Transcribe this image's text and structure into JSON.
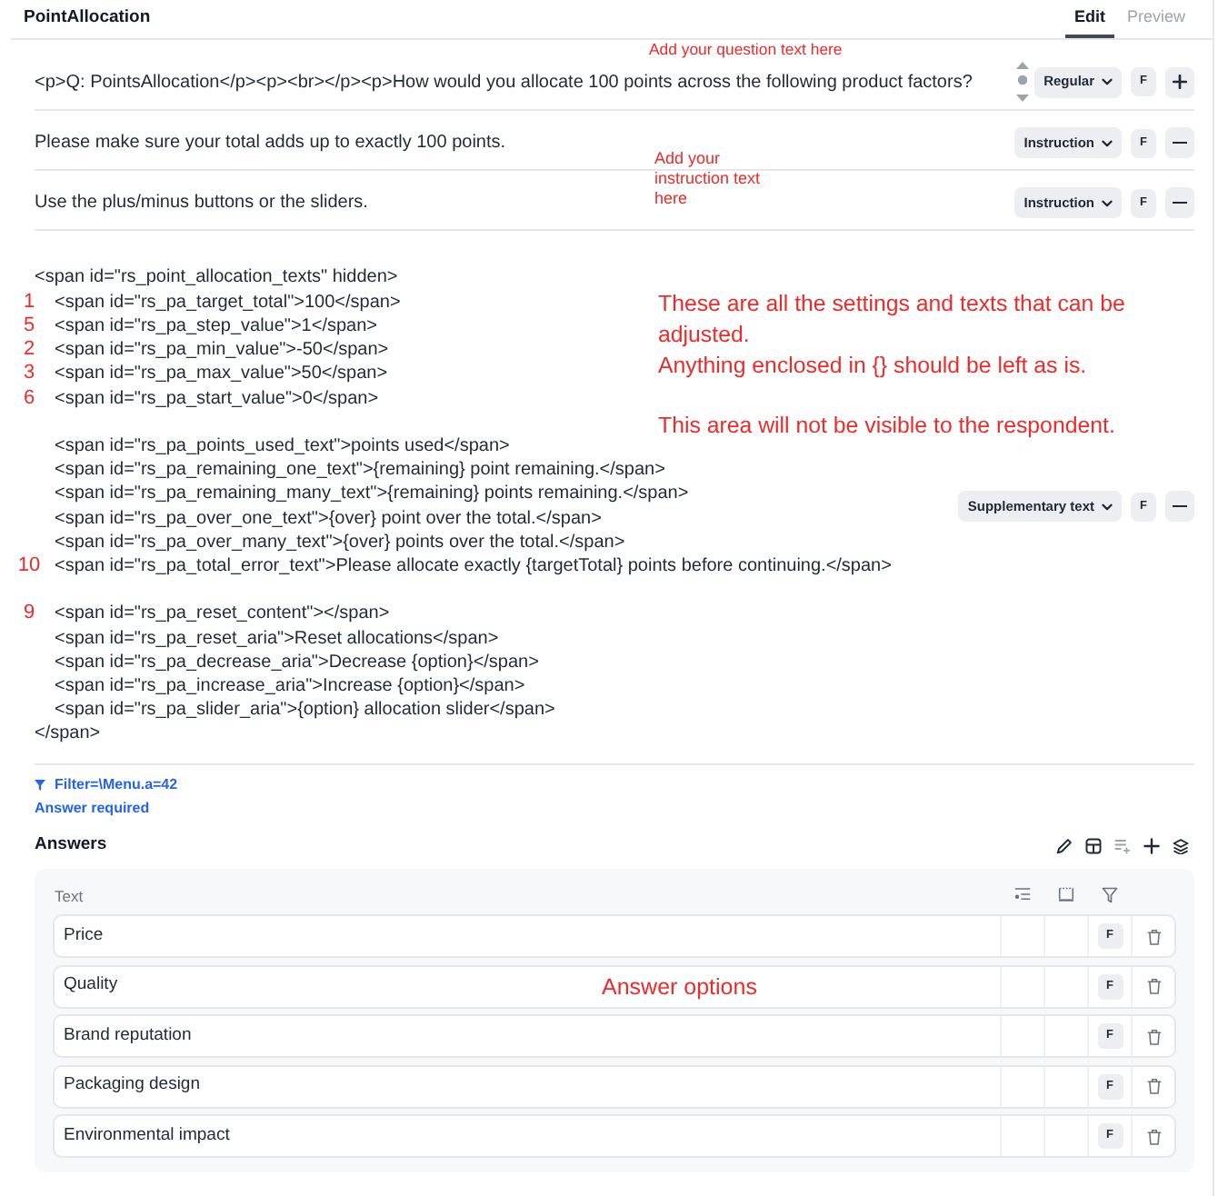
{
  "header": {
    "title": "PointAllocation",
    "tabs": [
      {
        "label": "Edit",
        "selected": true
      },
      {
        "label": "Preview",
        "selected": false
      }
    ]
  },
  "text_rows": [
    {
      "kind": "plain",
      "text": "<p>Q: PointsAllocation</p><p><br></p><p>How would you allocate 100 points across the following product factors?",
      "reorder_handle": true,
      "style": "Regular",
      "flag": "F",
      "action_button": {
        "kind": "add"
      }
    },
    {
      "kind": "plain",
      "text": "Please make sure your total adds up to exactly 100 points.",
      "reorder_handle": false,
      "style": "Instruction",
      "flag": "F",
      "action_button": {
        "kind": "remove"
      }
    },
    {
      "kind": "plain",
      "text": "Use the plus/minus buttons or the sliders.",
      "reorder_handle": false,
      "style": "Instruction",
      "flag": "F",
      "action_button": {
        "kind": "remove"
      }
    },
    {
      "kind": "code",
      "open_tag": "<span id=\"rs_point_allocation_texts\" hidden>",
      "children": [
        {
          "lines": [
            {
              "marker": "1",
              "text": "<span id=\"rs_pa_target_total\">100</span>"
            },
            {
              "marker": "5",
              "text": "<span id=\"rs_pa_step_value\">1</span>"
            },
            {
              "marker": "2",
              "text": "<span id=\"rs_pa_min_value\">-50</span>"
            },
            {
              "marker": "3",
              "text": "<span id=\"rs_pa_max_value\">50</span>"
            },
            {
              "marker": "6",
              "text": "<span id=\"rs_pa_start_value\">0</span>"
            }
          ]
        },
        {
          "lines": [
            {
              "text": "<span id=\"rs_pa_points_used_text\">points used</span>"
            },
            {
              "text": "<span id=\"rs_pa_remaining_one_text\">{remaining} point remaining.</span>"
            },
            {
              "text": "<span id=\"rs_pa_remaining_many_text\">{remaining} points remaining.</span>"
            },
            {
              "text": "<span id=\"rs_pa_over_one_text\">{over} point over the total.</span>"
            },
            {
              "text": "<span id=\"rs_pa_over_many_text\">{over} points over the total.</span>"
            },
            {
              "marker": "10",
              "text": "<span id=\"rs_pa_total_error_text\">Please allocate exactly {targetTotal} points before continuing.</span>"
            }
          ]
        },
        {
          "lines": [
            {
              "marker": "9",
              "text": "<span id=\"rs_pa_reset_content\"></span>"
            },
            {
              "text": "<span id=\"rs_pa_reset_aria\">Reset allocations</span>"
            },
            {
              "text": "<span id=\"rs_pa_decrease_aria\">Decrease {option}</span>"
            },
            {
              "text": "<span id=\"rs_pa_increase_aria\">Increase {option}</span>"
            },
            {
              "text": "<span id=\"rs_pa_slider_aria\">{option} allocation slider</span>"
            }
          ]
        }
      ],
      "close_tag": "</span>",
      "reorder_handle": false,
      "style": "Supplementary text",
      "flag": "F",
      "action_button": {
        "kind": "remove"
      }
    }
  ],
  "filter": {
    "text": "Filter=\\Menu.a=42"
  },
  "requirement": "Answer required",
  "answers": {
    "title": "Answers",
    "toolbar": [
      {
        "kind": "edit",
        "disabled": false
      },
      {
        "kind": "layout",
        "disabled": false
      },
      {
        "kind": "list_add",
        "disabled": true
      },
      {
        "kind": "add",
        "disabled": false
      },
      {
        "kind": "layers",
        "disabled": false
      }
    ],
    "columns": [
      "Text"
    ],
    "rows": [
      {
        "text": "Price",
        "flag": "F"
      },
      {
        "text": "Quality",
        "flag": "F"
      },
      {
        "text": "Brand reputation",
        "flag": "F"
      },
      {
        "text": "Packaging design",
        "flag": "F"
      },
      {
        "text": "Environmental impact",
        "flag": "F"
      }
    ]
  },
  "annotations": [
    {
      "text": "Add your question text here"
    },
    {
      "text": "Add your instruction text here"
    },
    {
      "paragraphs": [
        [
          "These are all the settings and texts that can be adjusted.",
          "Anything enclosed in {} should be left as is."
        ],
        [
          "This area will not be visible to the respondent."
        ]
      ]
    },
    {
      "text": "Answer options"
    }
  ]
}
